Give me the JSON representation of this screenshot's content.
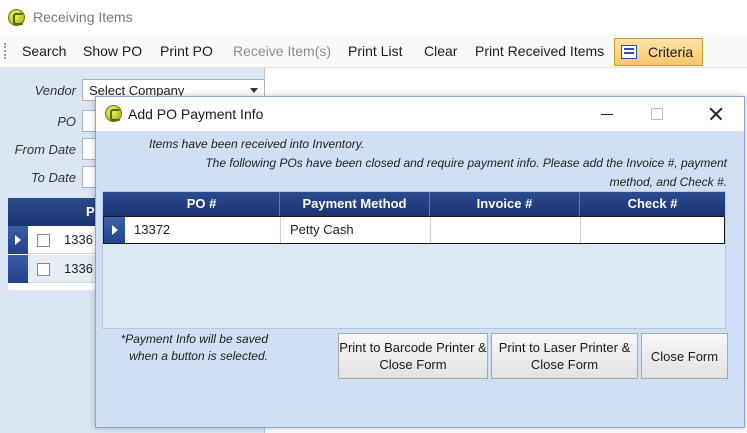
{
  "app": {
    "title": "Receiving Items"
  },
  "toolbar": {
    "items": [
      {
        "label": "Search",
        "enabled": true
      },
      {
        "label": "Show PO",
        "enabled": true
      },
      {
        "label": "Print PO",
        "enabled": true
      },
      {
        "label": "Receive Item(s)",
        "enabled": false
      },
      {
        "label": "Print List",
        "enabled": true
      },
      {
        "label": "Clear",
        "enabled": true
      },
      {
        "label": "Print Received Items",
        "enabled": true
      }
    ],
    "criteria_label": "Criteria"
  },
  "filters": {
    "vendor_label": "Vendor",
    "vendor_value": "Select Company",
    "po_label": "PO",
    "from_date_label": "From Date",
    "to_date_label": "To Date"
  },
  "background_grid": {
    "header_partial": "P",
    "rows": [
      {
        "po": "1336"
      },
      {
        "po": "1336"
      }
    ]
  },
  "dialog": {
    "title": "Add PO Payment Info",
    "message_line1": "Items have been received into Inventory.",
    "message_line2": "The following POs have been closed and require payment info. Please add the Invoice #, payment",
    "message_line3": "method, and Check #.",
    "columns": [
      "PO #",
      "Payment Method",
      "Invoice #",
      "Check #"
    ],
    "rows": [
      {
        "po": "13372",
        "payment_method": "Petty Cash",
        "invoice": "",
        "check": ""
      }
    ],
    "note": "*Payment Info will be saved when a button is selected.",
    "buttons": {
      "barcode": "Print to Barcode Printer & Close Form",
      "laser": "Print to Laser Printer & Close Form",
      "close": "Close Form"
    }
  },
  "colors": {
    "grid_header": "#1d3672",
    "dialog_body": "#cfe0f5",
    "criteria_highlight": "#f9c76a"
  }
}
